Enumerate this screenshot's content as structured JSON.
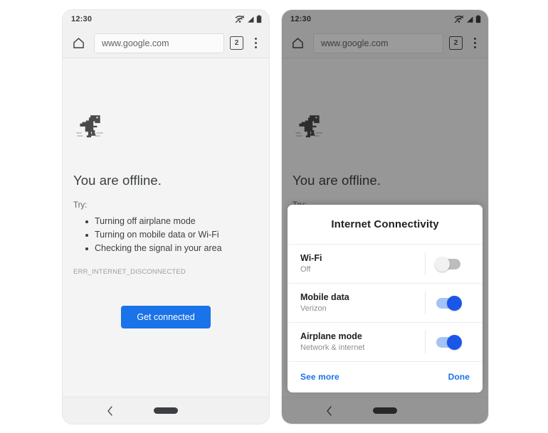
{
  "phones": [
    {
      "id": "phone-offline",
      "dimmed": false,
      "statusbar": {
        "time": "12:30",
        "icons": [
          "wifi-off-icon",
          "signal-off-icon",
          "battery-icon"
        ]
      },
      "toolbar": {
        "home_icon": "home-icon",
        "url": "www.google.com",
        "tab_count": "2",
        "menu_icon": "kebab-menu-icon"
      },
      "page": {
        "dino_icon": "dinosaur-icon",
        "title": "You are offline.",
        "try_label": "Try:",
        "suggestions": [
          "Turning off airplane mode",
          "Turning on mobile data or Wi-Fi",
          "Checking the signal in your area"
        ],
        "error_code": "ERR_INTERNET_DISCONNECTED",
        "cta_label": "Get connected"
      },
      "navbar": {
        "back_icon": "back-chevron-icon",
        "pill_icon": "home-pill-icon"
      }
    },
    {
      "id": "phone-dialog",
      "dimmed": true,
      "statusbar": {
        "time": "12:30",
        "icons": [
          "wifi-off-icon",
          "signal-off-icon",
          "battery-icon"
        ]
      },
      "toolbar": {
        "home_icon": "home-icon",
        "url": "www.google.com",
        "tab_count": "2",
        "menu_icon": "kebab-menu-icon"
      },
      "page": {
        "dino_icon": "dinosaur-icon",
        "title": "You are offline.",
        "try_label": "Try:",
        "suggestions": [
          "Turning off airplane mode",
          "Turning on mobile data or Wi-Fi",
          "Checking the signal in your area"
        ],
        "error_code": "ERR_INTERNET_DISCONNECTED",
        "cta_label": "Get connected"
      },
      "navbar": {
        "back_icon": "back-chevron-icon",
        "pill_icon": "home-pill-icon"
      }
    }
  ],
  "sheet": {
    "title": "Internet Connectivity",
    "rows": [
      {
        "title": "Wi-Fi",
        "subtitle": "Off",
        "state": "off"
      },
      {
        "title": "Mobile data",
        "subtitle": "Verizon",
        "state": "on"
      },
      {
        "title": "Airplane mode",
        "subtitle": "Network & internet",
        "state": "on"
      }
    ],
    "see_more_label": "See more",
    "done_label": "Done"
  },
  "colors": {
    "accent_blue": "#1a73e8",
    "toggle_on_knob": "#1a56e8",
    "toggle_on_track": "#a6c3f5",
    "toggle_off_track": "#bdbdbd",
    "screen_bg": "#f4f4f4",
    "text_primary": "#3c4043",
    "text_secondary": "#5f6368",
    "error_code_color": "#9aa0a6"
  }
}
